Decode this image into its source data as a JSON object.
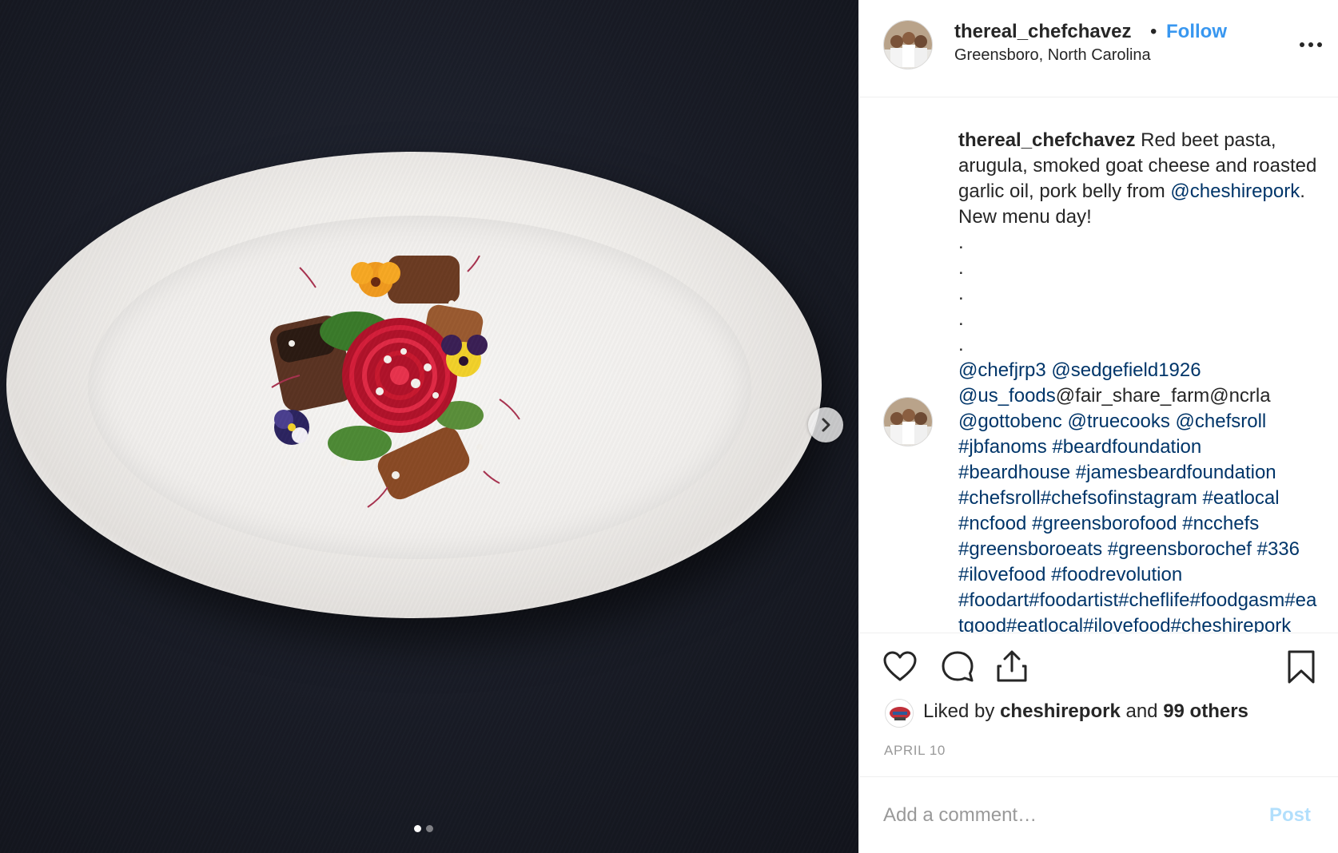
{
  "post": {
    "username": "thereal_chefchavez",
    "separator": "•",
    "follow_label": "Follow",
    "location": "Greensboro, North Carolina",
    "more_icon": "more-horizontal-icon"
  },
  "media": {
    "carousel_dots": 2,
    "active_dot": 1,
    "next_icon": "chevron-right-icon"
  },
  "caption": {
    "username": "thereal_chefchavez",
    "text_1": " Red beet pasta, arugula, smoked goat cheese and roasted garlic oil, pork belly from ",
    "mention_1": "@cheshirepork",
    "text_2": ". New menu day!",
    "dots": [
      ".",
      ".",
      ".",
      ".",
      "."
    ],
    "mentions_a": "@chefjrp3 @sedgefield1926",
    "mentions_b": "@us_foods",
    "text_3": "@fair_share_farm@ncrla",
    "mentions_c": "@gottobenc @truecooks @chefsroll #jbfanoms #beardfoundation #beardhouse #jamesbeardfoundation #chefsroll#chefsofinstagram #eatlocal #ncfood #greensborofood #ncchefs #greensboroeats #greensborochef #336 #ilovefood #foodrevolution #foodart#foodartist#cheflife#foodgasm#eatgood#eatlocal#ilovefood#cheshirepork"
  },
  "actions": {
    "like_icon": "heart-icon",
    "comment_icon": "comment-icon",
    "share_icon": "share-icon",
    "save_icon": "bookmark-icon"
  },
  "likes": {
    "prefix": "Liked by ",
    "user": "cheshirepork",
    "middle": " and ",
    "others": "99 others"
  },
  "date": "APRIL 10",
  "comment": {
    "placeholder": "Add a comment…",
    "post_label": "Post"
  },
  "colors": {
    "link": "#003569",
    "follow": "#3897f0",
    "post_disabled": "#b2dffc",
    "muted": "#999999"
  }
}
